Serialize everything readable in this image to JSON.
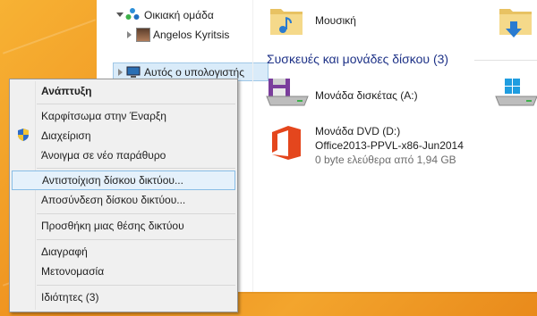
{
  "navigation": {
    "homegroup_label": "Οικιακή ομάδα",
    "user_label": "Angelos Kyritsis",
    "computer_label": "Αυτός ο υπολογιστής"
  },
  "content": {
    "music_label": "Μουσική",
    "group_header": "Συσκευές και μονάδες δίσκου (3)",
    "floppy_label": "Μονάδα δισκέτας (A:)",
    "dvd_label": "Μονάδα DVD (D:)",
    "dvd_volume": "Office2013-PPVL-x86-Jun2014",
    "dvd_space": "0 byte ελεύθερα από 1,94 GB"
  },
  "context_menu": {
    "expand": "Ανάπτυξη",
    "pin_start": "Καρφίτσωμα στην Έναρξη",
    "manage": "Διαχείριση",
    "open_new_window": "Άνοιγμα σε νέο παράθυρο",
    "map_network_drive": "Αντιστοίχιση δίσκου δικτύου...",
    "disconnect_network_drive": "Αποσύνδεση δίσκου δικτύου...",
    "add_network_location": "Προσθήκη μιας θέσης δικτύου",
    "delete": "Διαγραφή",
    "rename": "Μετονομασία",
    "properties": "Ιδιότητες (3)"
  },
  "colors": {
    "desktop_accent": "#f0a028",
    "menu_background": "#f0f0f0",
    "menu_hover": "#e5f1fb",
    "group_header": "#1e3287",
    "office_logo": "#e4461d"
  },
  "icons": [
    "homegroup-icon",
    "user-avatar-icon",
    "computer-icon",
    "music-folder-icon",
    "downloads-folder-icon",
    "floppy-drive-icon",
    "windows-drive-icon",
    "office-logo-icon",
    "shield-icon"
  ]
}
